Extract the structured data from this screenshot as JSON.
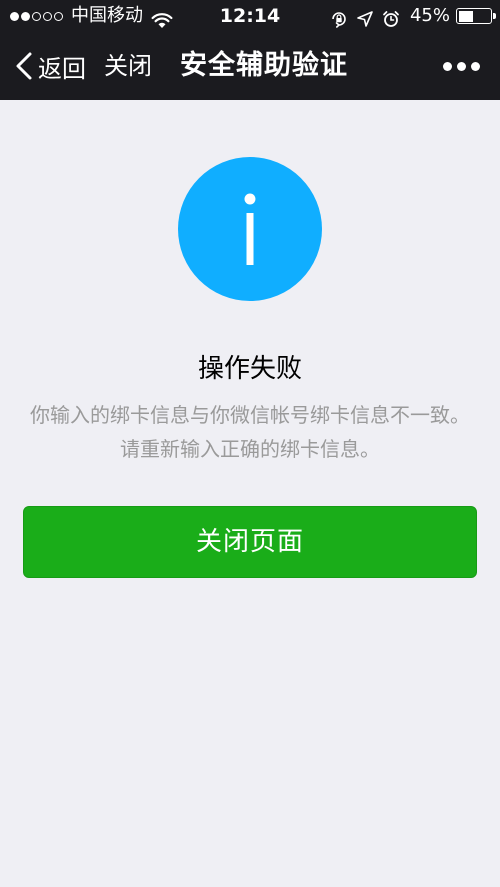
{
  "status_bar": {
    "carrier": "中国移动",
    "time": "12:14",
    "battery_percent": "45%",
    "battery_level": 0.45,
    "signal_strength": 2,
    "signal_total": 5,
    "icons": [
      "wifi-icon",
      "orientation-lock-icon",
      "location-icon",
      "alarm-icon",
      "battery-icon"
    ]
  },
  "nav": {
    "back_label": "返回",
    "close_label": "关闭",
    "title": "安全辅助验证",
    "more_icon": "more-dots-icon"
  },
  "content": {
    "icon": "info-icon",
    "icon_color": "#10aeff",
    "title": "操作失败",
    "description": "你输入的绑卡信息与你微信帐号绑卡信息不一致。请重新输入正确的绑卡信息。"
  },
  "actions": {
    "primary_label": "关闭页面",
    "primary_color": "#1aad19"
  }
}
